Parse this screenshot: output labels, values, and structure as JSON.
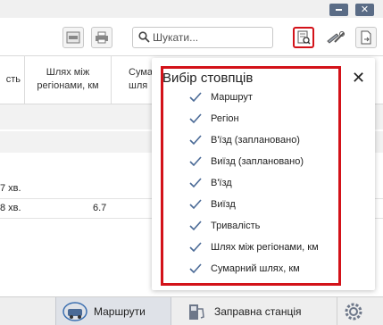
{
  "window": {
    "close_glyph": "✕"
  },
  "toolbar": {
    "search": {
      "placeholder": "Шукати..."
    },
    "icons": [
      "file-icon",
      "printer-icon",
      "search-icon",
      "column-select-icon",
      "tools-icon",
      "export-icon"
    ]
  },
  "table": {
    "headers": [
      {
        "text": "сть"
      },
      {
        "text": "Шлях між регіонами, км"
      },
      {
        "text": "Сума шля"
      }
    ],
    "rows": [
      {
        "c0": "7 хв.",
        "c1": ""
      },
      {
        "c0": "8 хв.",
        "c1": "6.7"
      }
    ]
  },
  "column_picker": {
    "title": "Вибір стовпців",
    "close_glyph": "✕",
    "options": [
      {
        "label": "Маршрут",
        "checked": true
      },
      {
        "label": "Регіон",
        "checked": true
      },
      {
        "label": "В'їзд (заплановано)",
        "checked": true
      },
      {
        "label": "Виїзд (заплановано)",
        "checked": true
      },
      {
        "label": "В'їзд",
        "checked": true
      },
      {
        "label": "Виїзд",
        "checked": true
      },
      {
        "label": "Тривалість",
        "checked": true
      },
      {
        "label": "Шлях між регіонами, км",
        "checked": true
      },
      {
        "label": "Сумарний шлях, км",
        "checked": true
      }
    ]
  },
  "bottom_nav": {
    "routes_label": "Маршрути",
    "station_label": "Заправна станція"
  },
  "colors": {
    "accent_red": "#d31219",
    "window_button": "#5a6c86",
    "check_blue": "#4a6a96"
  }
}
